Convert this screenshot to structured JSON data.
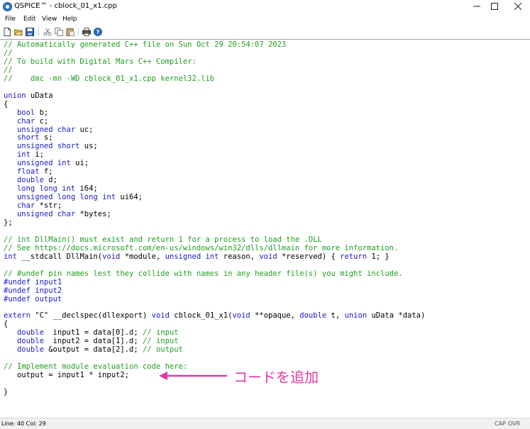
{
  "window": {
    "title": "QSPICE™ - cblock_01_x1.cpp",
    "minimize": "—",
    "maximize": "☐",
    "close": "✕"
  },
  "menu": [
    "File",
    "Edit",
    "View",
    "Help"
  ],
  "toolbar": {
    "icons": [
      "new-file-icon",
      "open-folder-icon",
      "save-icon",
      "cut-icon",
      "copy-icon",
      "paste-icon",
      "print-icon",
      "help-icon"
    ]
  },
  "code": [
    [
      {
        "t": "// Automatically generated C++ file on Sun Oct 29 20:54:07 2023",
        "c": "cm"
      }
    ],
    [
      {
        "t": "//",
        "c": "cm"
      }
    ],
    [
      {
        "t": "// To build with Digital Mars C++ Compiler:",
        "c": "cm"
      }
    ],
    [
      {
        "t": "//",
        "c": "cm"
      }
    ],
    [
      {
        "t": "//    dmc -mn -WD cblock_01_x1.cpp kernel32.lib",
        "c": "cm"
      }
    ],
    [],
    [
      {
        "t": "union",
        "c": "kw"
      },
      {
        "t": " uData"
      }
    ],
    [
      {
        "t": "{"
      }
    ],
    [
      {
        "t": "   "
      },
      {
        "t": "bool",
        "c": "kw"
      },
      {
        "t": " b;"
      }
    ],
    [
      {
        "t": "   "
      },
      {
        "t": "char",
        "c": "kw"
      },
      {
        "t": " c;"
      }
    ],
    [
      {
        "t": "   "
      },
      {
        "t": "unsigned char",
        "c": "kw"
      },
      {
        "t": " uc;"
      }
    ],
    [
      {
        "t": "   "
      },
      {
        "t": "short",
        "c": "kw"
      },
      {
        "t": " s;"
      }
    ],
    [
      {
        "t": "   "
      },
      {
        "t": "unsigned short",
        "c": "kw"
      },
      {
        "t": " us;"
      }
    ],
    [
      {
        "t": "   "
      },
      {
        "t": "int",
        "c": "kw"
      },
      {
        "t": " i;"
      }
    ],
    [
      {
        "t": "   "
      },
      {
        "t": "unsigned int",
        "c": "kw"
      },
      {
        "t": " ui;"
      }
    ],
    [
      {
        "t": "   "
      },
      {
        "t": "float",
        "c": "kw"
      },
      {
        "t": " f;"
      }
    ],
    [
      {
        "t": "   "
      },
      {
        "t": "double",
        "c": "kw"
      },
      {
        "t": " d;"
      }
    ],
    [
      {
        "t": "   "
      },
      {
        "t": "long long int",
        "c": "kw"
      },
      {
        "t": " i64;"
      }
    ],
    [
      {
        "t": "   "
      },
      {
        "t": "unsigned long long int",
        "c": "kw"
      },
      {
        "t": " ui64;"
      }
    ],
    [
      {
        "t": "   "
      },
      {
        "t": "char",
        "c": "kw"
      },
      {
        "t": " *str;"
      }
    ],
    [
      {
        "t": "   "
      },
      {
        "t": "unsigned char",
        "c": "kw"
      },
      {
        "t": " *bytes;"
      }
    ],
    [
      {
        "t": "};"
      }
    ],
    [],
    [
      {
        "t": "// int DllMain() must exist and return 1 for a process to load the .DLL",
        "c": "cm"
      }
    ],
    [
      {
        "t": "// See https://docs.microsoft.com/en-us/windows/win32/dlls/dllmain for more information.",
        "c": "cm"
      }
    ],
    [
      {
        "t": "int",
        "c": "kw"
      },
      {
        "t": " __stdcall DllMain("
      },
      {
        "t": "void",
        "c": "kw"
      },
      {
        "t": " *module, "
      },
      {
        "t": "unsigned int",
        "c": "kw"
      },
      {
        "t": " reason, "
      },
      {
        "t": "void",
        "c": "kw"
      },
      {
        "t": " *reserved) { "
      },
      {
        "t": "return",
        "c": "kw"
      },
      {
        "t": " 1; }"
      }
    ],
    [],
    [
      {
        "t": "// #undef pin names lest they collide with names in any header file(s) you might include.",
        "c": "cm"
      }
    ],
    [
      {
        "t": "#undef input1",
        "c": "kw"
      }
    ],
    [
      {
        "t": "#undef input2",
        "c": "kw"
      }
    ],
    [
      {
        "t": "#undef output",
        "c": "kw"
      }
    ],
    [],
    [
      {
        "t": "extern",
        "c": "kw"
      },
      {
        "t": " \"C\" __declspec(dllexport) "
      },
      {
        "t": "void",
        "c": "kw"
      },
      {
        "t": " cblock_01_x1("
      },
      {
        "t": "void",
        "c": "kw"
      },
      {
        "t": " **opaque, "
      },
      {
        "t": "double",
        "c": "kw"
      },
      {
        "t": " t, "
      },
      {
        "t": "union",
        "c": "kw"
      },
      {
        "t": " uData *data)"
      }
    ],
    [
      {
        "t": "{"
      }
    ],
    [
      {
        "t": "   "
      },
      {
        "t": "double",
        "c": "kw"
      },
      {
        "t": "  input1 = data[0].d; "
      },
      {
        "t": "// input",
        "c": "cm"
      }
    ],
    [
      {
        "t": "   "
      },
      {
        "t": "double",
        "c": "kw"
      },
      {
        "t": "  input2 = data[1].d; "
      },
      {
        "t": "// input",
        "c": "cm"
      }
    ],
    [
      {
        "t": "   "
      },
      {
        "t": "double",
        "c": "kw"
      },
      {
        "t": " &output = data[2].d; "
      },
      {
        "t": "// output",
        "c": "cm"
      }
    ],
    [],
    [
      {
        "t": "// Implement module evaluation code here:",
        "c": "cm"
      }
    ],
    [
      {
        "t": "   output = input1 * input2;"
      }
    ],
    [],
    [
      {
        "t": "}"
      }
    ]
  ],
  "annotation": {
    "text": "コードを追加",
    "color": "#e23aa6"
  },
  "status": {
    "position": "Line: 40 Col: 29",
    "cap": "CAP",
    "ovr": "OVR"
  },
  "colors": {
    "comment": "#1f9f1f",
    "keyword": "#1a1acc",
    "text": "#000000"
  }
}
